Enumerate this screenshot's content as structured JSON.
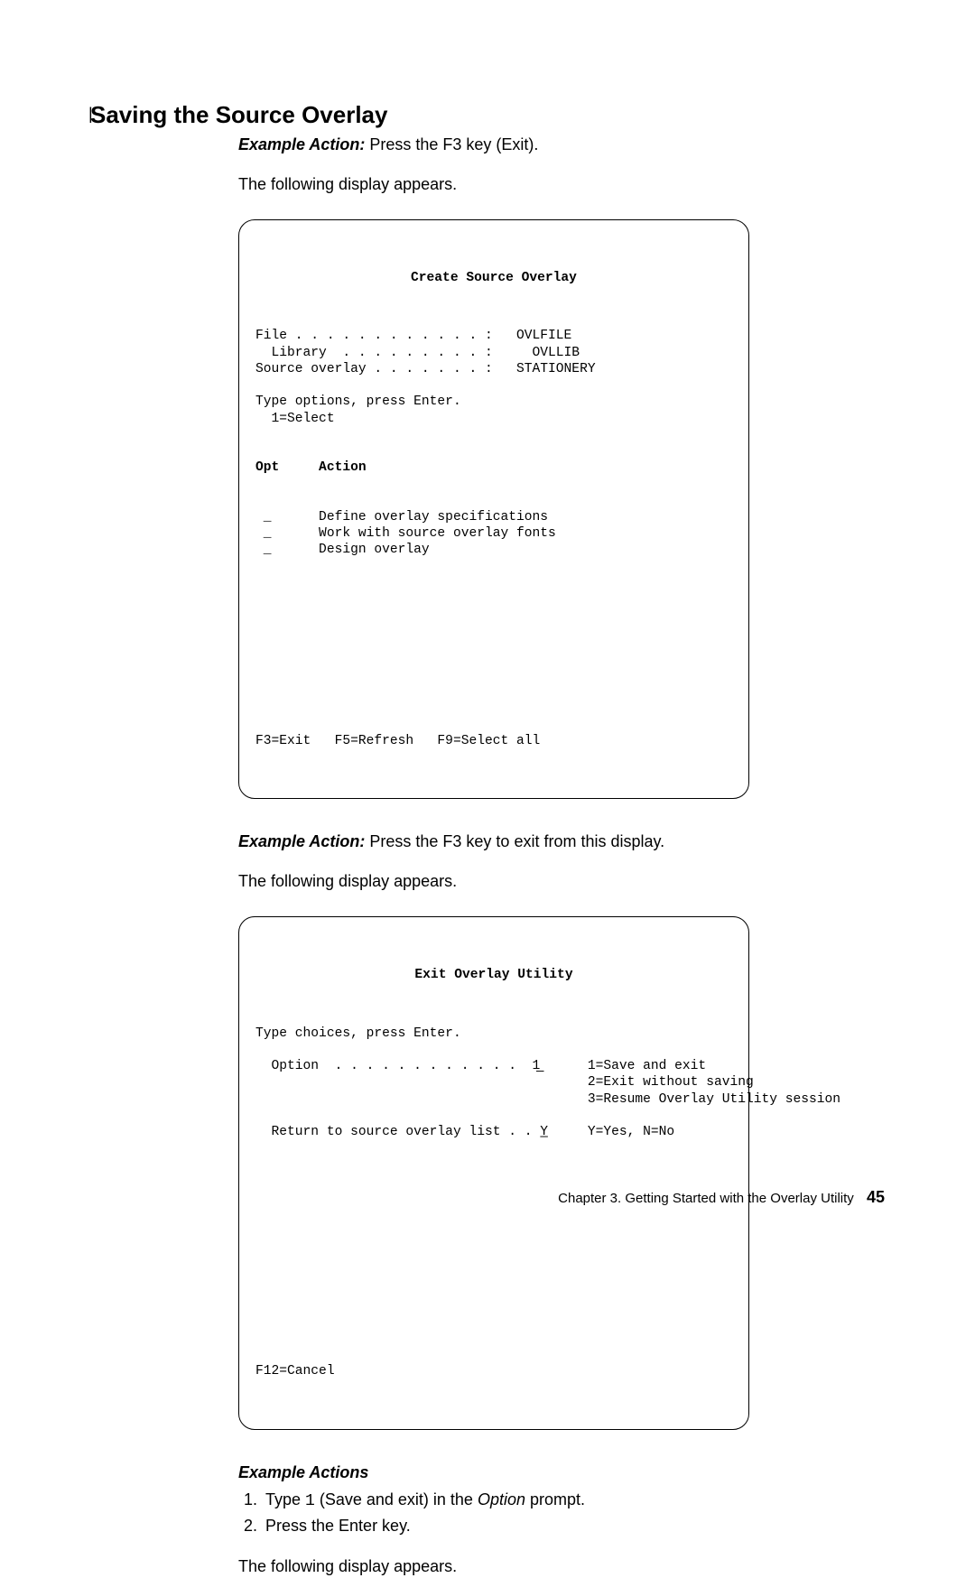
{
  "heading": "Saving the Source Overlay",
  "change_bar": "|",
  "para1_label": "Example Action:",
  "para1_text": "  Press the F3 key (Exit).",
  "para2": "The following display appears.",
  "screen1": {
    "title": "Create Source Overlay",
    "body1": "File . . . . . . . . . . . . :   OVLFILE\n  Library  . . . . . . . . . :     OVLLIB\nSource overlay . . . . . . . :   STATIONERY\n\nType options, press Enter.\n  1=Select\n",
    "col_heads": "Opt     Action",
    "body2": " _      Define overlay specifications\n _      Work with source overlay fonts\n _      Design overlay",
    "fkeys": "F3=Exit   F5=Refresh   F9=Select all"
  },
  "para3_label": "Example Action:",
  "para3_text": "  Press the F3 key to exit from this display.",
  "para4": "The following display appears.",
  "screen2": {
    "title": "Exit Overlay Utility",
    "body": "Type choices, press Enter.\n\n  Option  . . . . . . . . . . . .  1̲      1=Save and exit\n                                          2=Exit without saving\n                                          3=Resume Overlay Utility session\n\n  Return to source overlay list . . Y̲     Y=Yes, N=No",
    "fkeys": "F12=Cancel"
  },
  "subhead": "Example Actions",
  "steps": {
    "s1a": "Type ",
    "s1b": "1",
    "s1c": " (Save and exit) in the ",
    "s1d": "Option",
    "s1e": " prompt.",
    "s2": "Press the Enter key."
  },
  "para5": "The following display appears.",
  "footer_text": "Chapter 3. Getting Started with the Overlay Utility",
  "footer_page": "45"
}
